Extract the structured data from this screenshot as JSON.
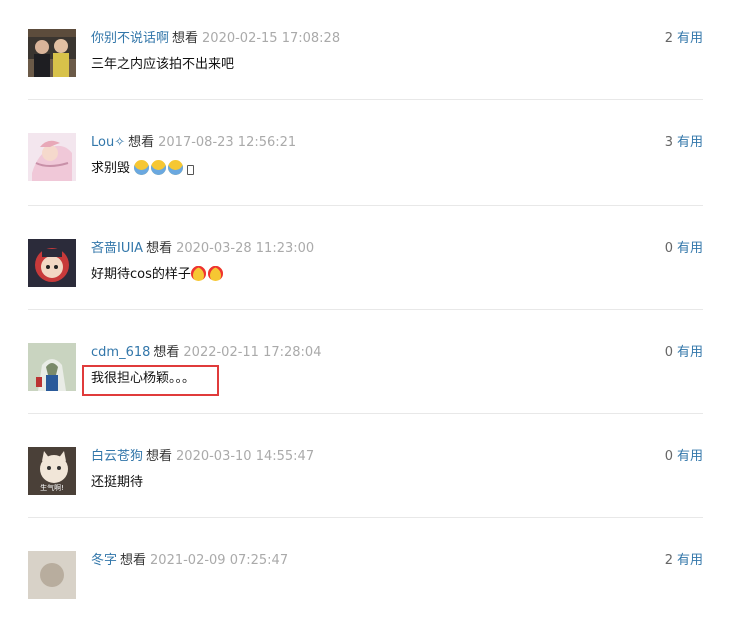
{
  "comments": [
    {
      "user": "你别不说话啊",
      "status": "想看",
      "time": "2020-02-15 17:08:28",
      "votes": "2",
      "vote_label": "有用",
      "text": "三年之内应该拍不出来吧"
    },
    {
      "user": "Lou✧",
      "status": "想看",
      "time": "2017-08-23 12:56:21",
      "votes": "3",
      "vote_label": "有用",
      "text": "求别毁"
    },
    {
      "user": "吝啬IUIA",
      "status": "想看",
      "time": "2020-03-28 11:23:00",
      "votes": "0",
      "vote_label": "有用",
      "text": "好期待cos的样子"
    },
    {
      "user": "cdm_618",
      "status": "想看",
      "time": "2022-02-11 17:28:04",
      "votes": "0",
      "vote_label": "有用",
      "text": "我很担心杨颖。。。"
    },
    {
      "user": "白云苍狗",
      "status": "想看",
      "time": "2020-03-10 14:55:47",
      "votes": "0",
      "vote_label": "有用",
      "text": "还挺期待",
      "avatar_caption": "生气啊!"
    },
    {
      "user": "冬字",
      "status": "想看",
      "time": "2021-02-09 07:25:47",
      "votes": "2",
      "vote_label": "有用",
      "text": ""
    }
  ],
  "emoji": {
    "scream_icon": "scream-emoji",
    "heart_eyes_icon": "heart-eyes-emoji",
    "phone_icon": "mobile-phone-icon"
  },
  "colors": {
    "username": "#3377aa",
    "timestamp": "#aaaaaa",
    "highlight": "#e03b3b"
  }
}
